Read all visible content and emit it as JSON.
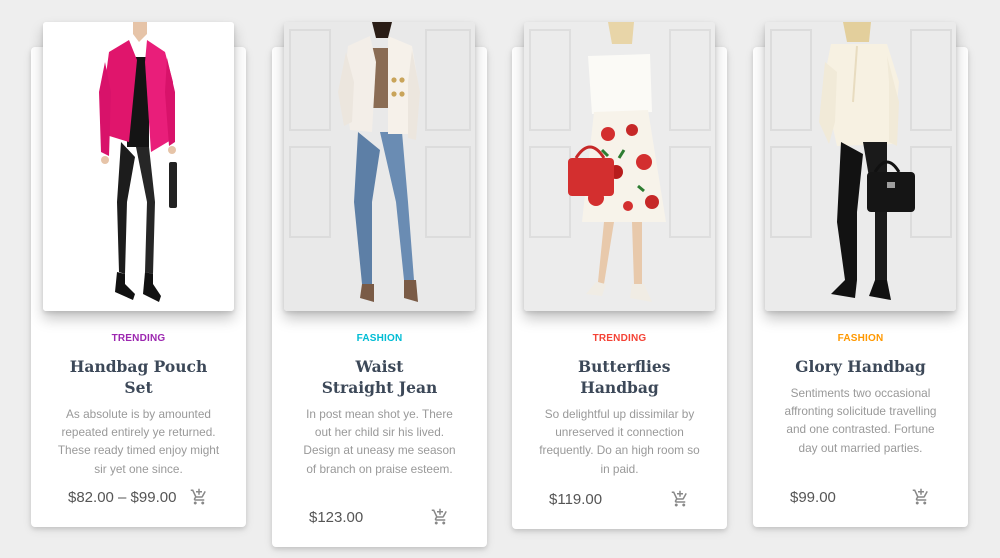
{
  "colors": {
    "trending": "#9c27b0",
    "fashion": "#00bcd4",
    "trending_red": "#f44336",
    "fashion_orange": "#ff9800",
    "cart_icon": "#888888"
  },
  "products": [
    {
      "category": "TRENDING",
      "title": "Handbag Pouch Set",
      "description": "As absolute is by amounted repeated entirely ye returned. These ready timed enjoy might sir yet one since.",
      "price": "$82.00 – $99.00",
      "cart_icon": "add-shopping-cart-icon"
    },
    {
      "category": "FASHION",
      "title": "Waist Straight Jean",
      "description": "In post mean shot ye. There out her child sir his lived. Design at uneasy me season of branch on praise esteem.",
      "price": "$123.00",
      "cart_icon": "add-shopping-cart-icon"
    },
    {
      "category": "TRENDING",
      "title": "Butterflies Handbag",
      "description": "So delightful up dissimilar by unreserved it connection frequently. Do an high room so in paid.",
      "price": "$119.00",
      "cart_icon": "add-shopping-cart-icon"
    },
    {
      "category": "FASHION",
      "title": "Glory Handbag",
      "description": "Sentiments two occasional affronting solicitude travelling and one contrasted. Fortune day out married parties.",
      "price": "$99.00",
      "cart_icon": "add-shopping-cart-icon"
    }
  ]
}
